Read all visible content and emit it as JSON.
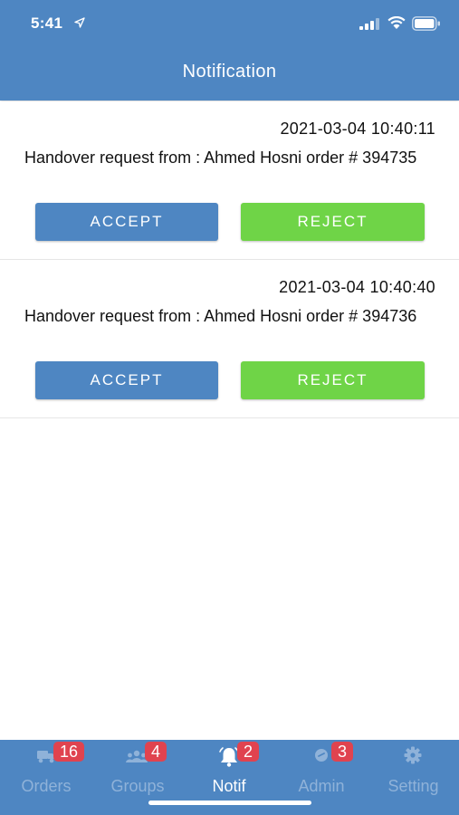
{
  "status_bar": {
    "time": "5:41"
  },
  "header": {
    "title": "Notification"
  },
  "notifications": [
    {
      "timestamp": "2021-03-04 10:40:11",
      "message": "Handover request from : Ahmed Hosni order # 394735",
      "accept_label": "ACCEPT",
      "reject_label": "REJECT"
    },
    {
      "timestamp": "2021-03-04 10:40:40",
      "message": "Handover request from : Ahmed Hosni order # 394736",
      "accept_label": "ACCEPT",
      "reject_label": "REJECT"
    }
  ],
  "tabs": [
    {
      "label": "Orders",
      "badge": "16",
      "icon": "truck-icon",
      "active": false
    },
    {
      "label": "Groups",
      "badge": "4",
      "icon": "group-icon",
      "active": false
    },
    {
      "label": "Notif",
      "badge": "2",
      "icon": "bell-icon",
      "active": true
    },
    {
      "label": "Admin",
      "badge": "3",
      "icon": "admin-icon",
      "active": false
    },
    {
      "label": "Setting",
      "badge": "",
      "icon": "gear-icon",
      "active": false
    }
  ],
  "colors": {
    "primary": "#4e86c2",
    "reject": "#6fd447",
    "badge": "#e0434f"
  }
}
